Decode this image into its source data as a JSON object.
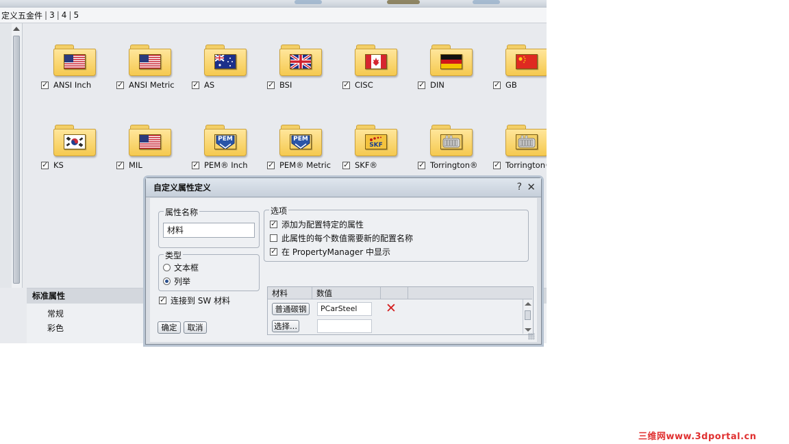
{
  "tabs": [
    "定义五金件",
    "3",
    "4",
    "5"
  ],
  "library_items": [
    {
      "label": "ANSI Inch",
      "checked": true,
      "emblem": "us-flag-icon"
    },
    {
      "label": "ANSI Metric",
      "checked": true,
      "emblem": "us-flag-icon"
    },
    {
      "label": "AS",
      "checked": true,
      "emblem": "australia-flag-icon"
    },
    {
      "label": "BSI",
      "checked": true,
      "emblem": "uk-flag-icon"
    },
    {
      "label": "CISC",
      "checked": true,
      "emblem": "canada-flag-icon"
    },
    {
      "label": "DIN",
      "checked": true,
      "emblem": "germany-flag-icon"
    },
    {
      "label": "GB",
      "checked": true,
      "emblem": "china-flag-icon"
    },
    {
      "label": "KS",
      "checked": true,
      "emblem": "korea-flag-icon"
    },
    {
      "label": "MIL",
      "checked": true,
      "emblem": "us-flag-icon"
    },
    {
      "label": "PEM® Inch",
      "checked": true,
      "emblem": "pem-logo-icon",
      "logo_text": "PEM"
    },
    {
      "label": "PEM® Metric",
      "checked": true,
      "emblem": "pem-logo-icon",
      "logo_text": "PEM"
    },
    {
      "label": "SKF®",
      "checked": true,
      "emblem": "skf-logo-icon",
      "logo_text": "SKF"
    },
    {
      "label": "Torrington®",
      "checked": true,
      "emblem": "bearing-icon"
    },
    {
      "label": "Torrington®",
      "checked": true,
      "emblem": "bearing-icon"
    }
  ],
  "bottom_panel": {
    "header": "标准属性",
    "rows": [
      "常规",
      "彩色"
    ]
  },
  "dialog": {
    "title": "自定义属性定义",
    "help_glyph": "?",
    "close_glyph": "✕",
    "property_name": {
      "legend": "属性名称",
      "value": "材料"
    },
    "type": {
      "legend": "类型",
      "options": [
        {
          "label": "文本框",
          "selected": false
        },
        {
          "label": "列举",
          "selected": true
        }
      ]
    },
    "link_sw_material": {
      "label": "连接到 SW 材料",
      "checked": true
    },
    "options": {
      "legend": "选项",
      "items": [
        {
          "label": "添加为配置特定的属性",
          "checked": true
        },
        {
          "label": "此属性的每个数值需要新的配置名称",
          "checked": false
        },
        {
          "label": "在 PropertyManager 中显示",
          "checked": true
        }
      ]
    },
    "table": {
      "headers": [
        "材料",
        "数值"
      ],
      "rows": [
        {
          "button": "普通碳钢",
          "value": "PCarSteel"
        },
        {
          "button": "选择...",
          "value": ""
        }
      ],
      "delete_glyph": "✕"
    },
    "ok_label": "确定",
    "cancel_label": "取消"
  },
  "watermark": "三维网www.3dportal.cn"
}
